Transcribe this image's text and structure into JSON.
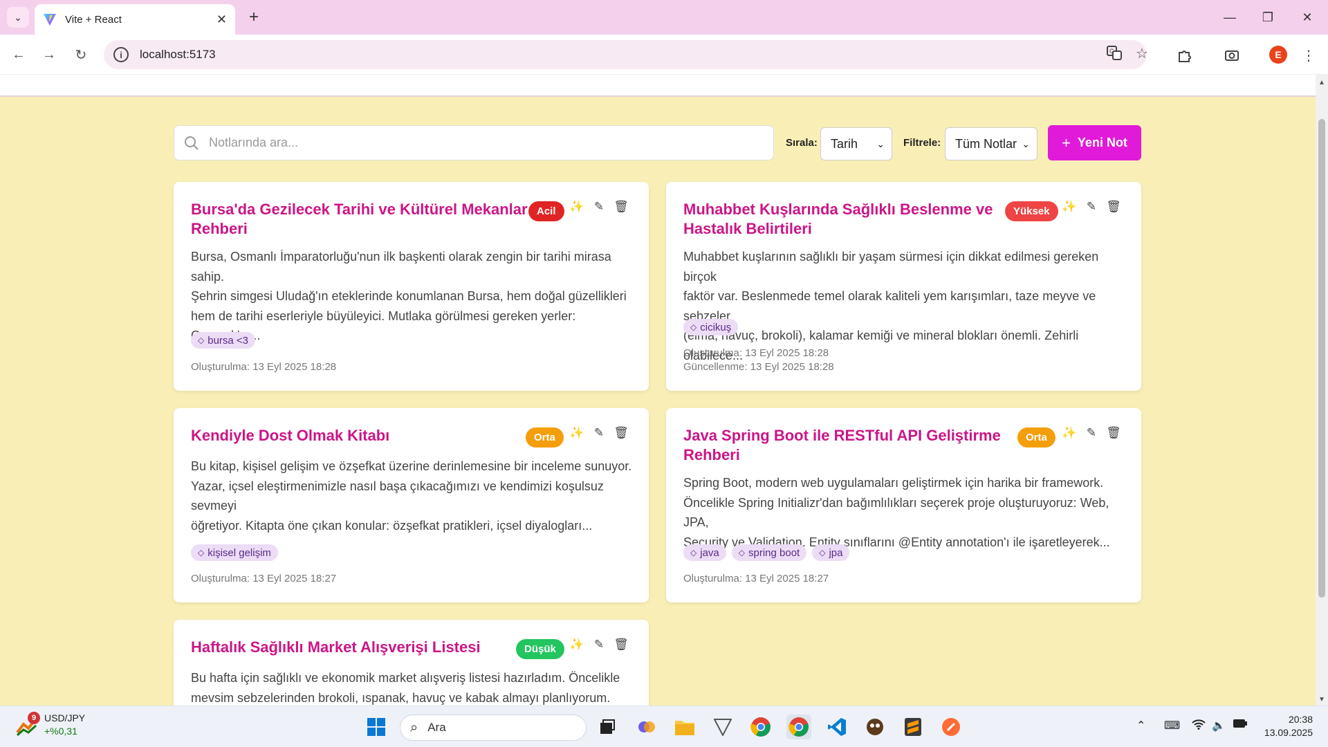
{
  "browser": {
    "tab_title": "Vite + React",
    "url": "localhost:5173"
  },
  "controls": {
    "search_placeholder": "Notlarında ara...",
    "sort_label": "Sırala:",
    "sort_value": "Tarih",
    "filter_label": "Filtrele:",
    "filter_value": "Tüm Notlar",
    "new_note_label": "Yeni Not"
  },
  "notes": [
    {
      "title_line1": "Bursa'da Gezilecek Tarihi ve Kültürel Mekanlar",
      "title_line2": "Rehberi",
      "priority": "Acil",
      "priority_color": "#e02424",
      "body_line1": "Bursa, Osmanlı İmparatorluğu'nun ilk başkenti olarak zengin bir tarihi mirasa sahip.",
      "body_line2": "Şehrin simgesi Uludağ'ın eteklerinde konumlanan Bursa, hem doğal güzellikleri",
      "body_line3": "hem de tarihi eserleriyle büyüleyici. Mutlaka görülmesi gereken yerler: Osmanlı'nı...",
      "tags": [
        "bursa <3"
      ],
      "created": "Oluşturulma: 13 Eyl 2025 18:28",
      "updated": ""
    },
    {
      "title_line1": "Muhabbet Kuşlarında Sağlıklı Beslenme ve",
      "title_line2": "Hastalık Belirtileri",
      "priority": "Yüksek",
      "priority_color": "#ef4444",
      "body_line1": "Muhabbet kuşlarının sağlıklı bir yaşam sürmesi için dikkat edilmesi gereken birçok",
      "body_line2": "faktör var. Beslenmede temel olarak kaliteli yem karışımları, taze meyve ve sebzeler",
      "body_line3": "(elma, havuç, brokoli), kalamar kemiği ve mineral blokları önemli. Zehirli olabilece...",
      "tags": [
        "cicikuş"
      ],
      "created": "Oluşturulma: 13 Eyl 2025 18:28",
      "updated": "Güncellenme: 13 Eyl 2025 18:28"
    },
    {
      "title_line1": "Kendiyle Dost Olmak Kitabı",
      "title_line2": "",
      "priority": "Orta",
      "priority_color": "#f59e0b",
      "body_line1": "Bu kitap, kişisel gelişim ve özşefkat üzerine derinlemesine bir inceleme sunuyor.",
      "body_line2": "Yazar, içsel eleştirmenimizle nasıl başa çıkacağımızı ve kendimizi koşulsuz sevmeyi",
      "body_line3": "öğretiyor. Kitapta öne çıkan konular: özşefkat pratikleri, içsel diyalogları...",
      "tags": [
        "kişisel gelişim"
      ],
      "created": "Oluşturulma: 13 Eyl 2025 18:27",
      "updated": ""
    },
    {
      "title_line1": "Java Spring Boot ile RESTful API Geliştirme",
      "title_line2": "Rehberi",
      "priority": "Orta",
      "priority_color": "#f59e0b",
      "body_line1": "Spring Boot, modern web uygulamaları geliştirmek için harika bir framework.",
      "body_line2": "Öncelikle Spring Initializr'dan bağımlılıkları seçerek proje oluşturuyoruz: Web, JPA,",
      "body_line3": "Security ve Validation. Entity sınıflarını @Entity annotation'ı ile işaretleyerek...",
      "tags": [
        "java",
        "spring boot",
        "jpa"
      ],
      "created": "Oluşturulma: 13 Eyl 2025 18:27",
      "updated": ""
    },
    {
      "title_line1": "Haftalık Sağlıklı Market Alışverişi Listesi",
      "title_line2": "",
      "priority": "Düşük",
      "priority_color": "#22c55e",
      "body_line1": "Bu hafta için sağlıklı ve ekonomik market alışveriş listesi hazırladım. Öncelikle",
      "body_line2": "mevsim sebzelerinden brokoli, ıspanak, havuç ve kabak almayı planlıyorum.",
      "body_line3": "",
      "tags": [],
      "created": "",
      "updated": ""
    }
  ],
  "taskbar": {
    "widget_badge": "9",
    "widget_title": "USD/JPY",
    "widget_change": "+%0,31",
    "search_label": "Ara",
    "time": "20:38",
    "date": "13.09.2025"
  }
}
